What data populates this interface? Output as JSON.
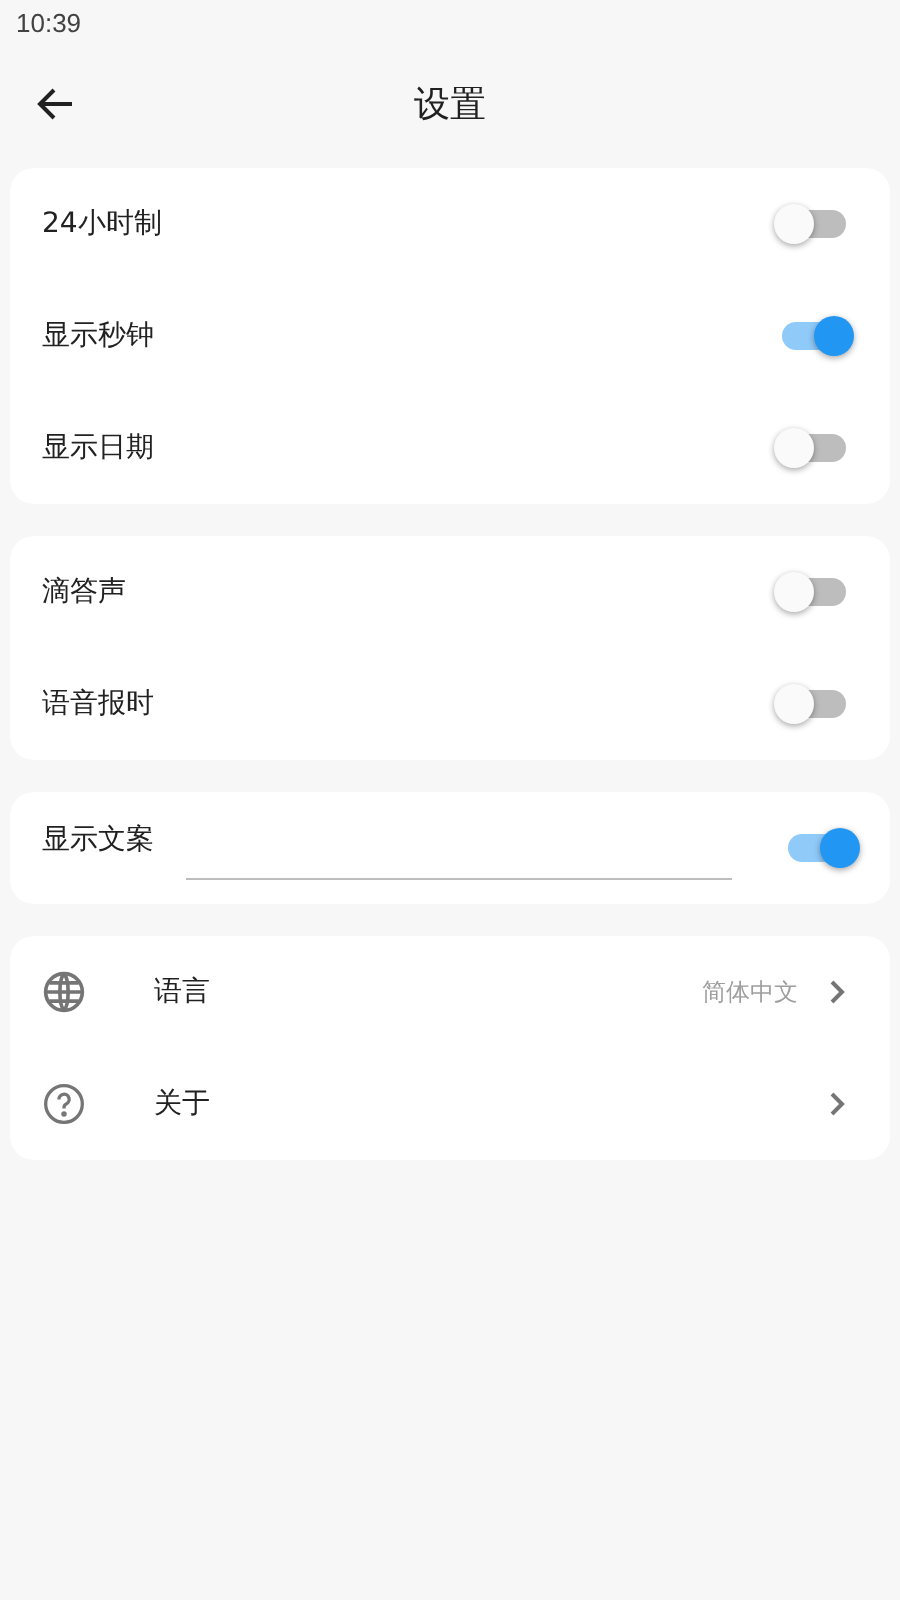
{
  "status_bar": {
    "time": "10:39"
  },
  "header": {
    "title": "设置"
  },
  "sections": [
    {
      "items": [
        {
          "kind": "switch",
          "label": "24小时制",
          "on": false
        },
        {
          "kind": "switch",
          "label": "显示秒钟",
          "on": true
        },
        {
          "kind": "switch",
          "label": "显示日期",
          "on": false
        }
      ]
    },
    {
      "items": [
        {
          "kind": "switch",
          "label": "滴答声",
          "on": false
        },
        {
          "kind": "switch",
          "label": "语音报时",
          "on": false
        }
      ]
    },
    {
      "items": [
        {
          "kind": "text_switch",
          "label": "显示文案",
          "on": true
        }
      ]
    },
    {
      "items": [
        {
          "kind": "link",
          "label": "语言",
          "value": "简体中文"
        },
        {
          "kind": "link",
          "label": "关于"
        }
      ]
    }
  ]
}
